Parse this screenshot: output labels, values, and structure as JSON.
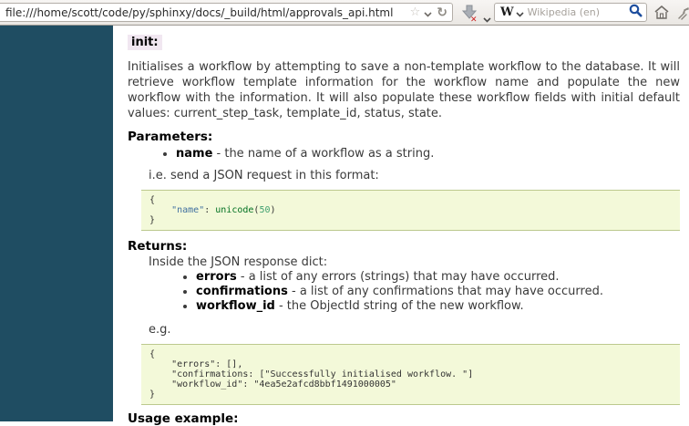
{
  "browser": {
    "url": "file:///home/scott/code/py/sphinxy/docs/_build/html/approvals_api.html",
    "search": {
      "engine_letter": "W",
      "placeholder": "Wikipedia (en)"
    },
    "icons": [
      "bookmark-star-icon",
      "dropdown-chevron-icon",
      "reload-icon",
      "download-icon",
      "search-engine-icon",
      "magnifier-icon",
      "home-icon",
      "plugin-icon"
    ]
  },
  "doc": {
    "init_label": "init:",
    "intro": "Initialises a workflow by attempting to save a non-template workflow to the database. It will retrieve workflow template information for the workflow name and populate the new workflow with the information. It will also populate these workflow fields with initial default values: current_step_task, template_id, status, state.",
    "parameters": {
      "heading": "Parameters:",
      "items": [
        {
          "term": "name",
          "desc": " - the name of a workflow as a string."
        }
      ],
      "note": "i.e. send a JSON request in this format:"
    },
    "code_request": {
      "l1": "{",
      "l2_indent": "    ",
      "l2_string": "\"name\"",
      "l2_sep": ": ",
      "l2_builtin": "unicode",
      "l2_paren_open": "(",
      "l2_number": "50",
      "l2_paren_close": ")",
      "l3": "}"
    },
    "returns": {
      "heading": "Returns:",
      "lead": "Inside the JSON response dict:",
      "items": [
        {
          "term": "errors",
          "desc": " - a list of any errors (strings) that may have occurred."
        },
        {
          "term": "confirmations",
          "desc": " - a list of any confirmations that may have occurred."
        },
        {
          "term": "workflow_id",
          "desc": " - the ObjectId string of the new workflow."
        }
      ]
    },
    "eg_label": "e.g.",
    "code_response": {
      "lines": [
        "{",
        "    \"errors\": [],",
        "    \"confirmations: [\"Successfully initialised workflow. \"]",
        "    \"workflow_id\": \"4ea5e2afcd8bbf1491000005\"",
        "}"
      ]
    },
    "usage_heading": "Usage example:"
  },
  "colors": {
    "sidebar_teal": "#1f4d62",
    "code_background": "#f3f9d9",
    "literal_background": "#f1e7f1",
    "token_string": "#4070a0",
    "token_builtin": "#007020",
    "token_number": "#40a070",
    "magnifier_blue": "#1d4e9e"
  }
}
